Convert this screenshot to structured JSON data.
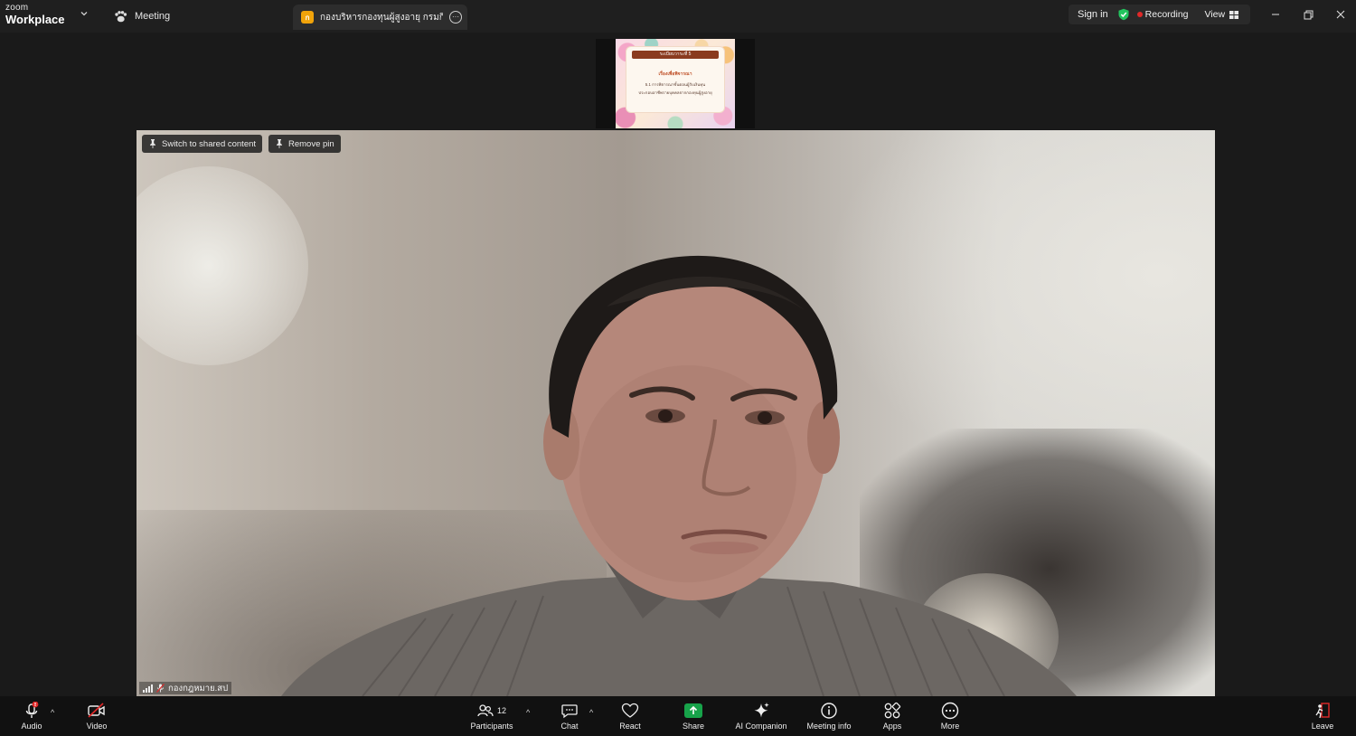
{
  "brand": {
    "line1": "zoom",
    "line2": "Workplace"
  },
  "tabs": {
    "meeting_label": "Meeting",
    "active": {
      "badge": "ก",
      "title": "กองบริหารกองทุนผู้สูงอายุ กรมกิจการผู้"
    }
  },
  "status": {
    "signin": "Sign in",
    "recording": "Recording",
    "view": "View"
  },
  "shared_slide": {
    "header": "ระเบียบวาระที่ 5",
    "subtitle": "เรื่องเพื่อพิจารณา",
    "line1": "5.1 การพิจารณาขั้นตอนผู้รับเงินทุน",
    "line2": "ประกอบอาชีพรายบุคคลจากกองทุนผู้สูงอายุ"
  },
  "video": {
    "switch_label": "Switch to shared content",
    "remove_pin_label": "Remove pin",
    "participant_name": "กองกฎหมาย.สป"
  },
  "toolbar": {
    "audio": "Audio",
    "video": "Video",
    "participants": "Participants",
    "participant_count": "12",
    "chat": "Chat",
    "react": "React",
    "share": "Share",
    "ai_companion": "AI Companion",
    "meeting_info": "Meeting info",
    "apps": "Apps",
    "more": "More",
    "leave": "Leave"
  },
  "colors": {
    "recording": "#e02828",
    "share": "#17a34a",
    "shield": "#22c55e",
    "leave": "#e02828"
  }
}
